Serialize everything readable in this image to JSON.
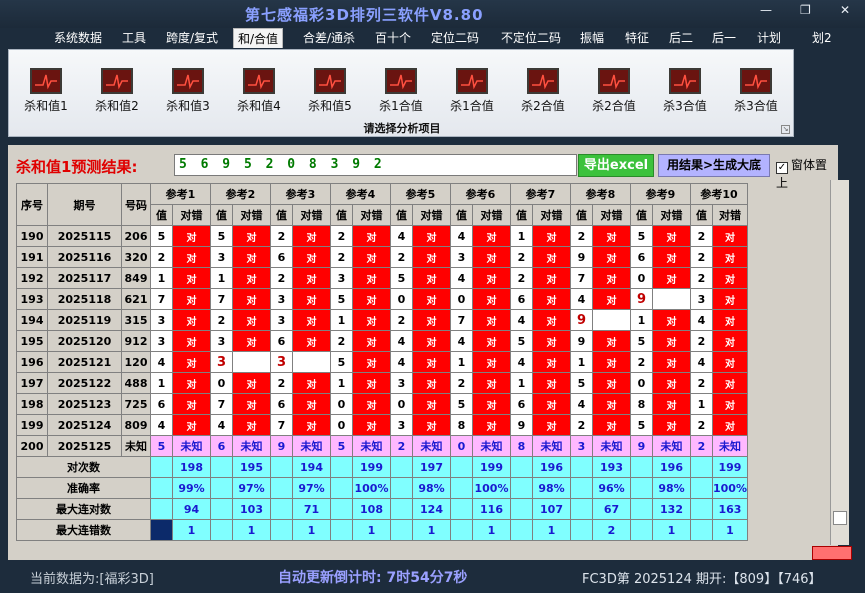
{
  "app": {
    "title": "第七感福彩3D排列三软件V8.80"
  },
  "menu": [
    "系统数据",
    "工具",
    "跨度/复式",
    "和/合值",
    "合差/通杀",
    "百十个",
    "定位二码",
    "不定位二码",
    "振幅",
    "特征",
    "后二",
    "后一",
    "计划",
    "划2"
  ],
  "ribbon": {
    "buttons": [
      "杀和值1",
      "杀和值2",
      "杀和值3",
      "杀和值4",
      "杀和值5",
      "杀1合值",
      "杀1合值",
      "杀2合值",
      "杀2合值",
      "杀3合值",
      "杀3合值"
    ],
    "caption": "请选择分析项目"
  },
  "predict": {
    "label": "杀和值1预测结果:",
    "value": "5 6 9 5 2 0 8 3 9 2",
    "excel_button": "导出excel",
    "base_button": "用结果>生成大底",
    "topmost_label": "窗体置上"
  },
  "table": {
    "headers": {
      "seq": "序号",
      "period": "期号",
      "code": "号码",
      "refs": [
        "参考1",
        "参考2",
        "参考3",
        "参考4",
        "参考5",
        "参考6",
        "参考7",
        "参考8",
        "参考9",
        "参考10"
      ],
      "sub_value": "值",
      "sub_result": "对错"
    },
    "rows": [
      {
        "seq": "190",
        "period": "2025115",
        "code": "206",
        "cells": [
          [
            "5",
            "对"
          ],
          [
            "5",
            "对"
          ],
          [
            "2",
            "对"
          ],
          [
            "2",
            "对"
          ],
          [
            "4",
            "对"
          ],
          [
            "4",
            "对"
          ],
          [
            "1",
            "对"
          ],
          [
            "2",
            "对"
          ],
          [
            "5",
            "对"
          ],
          [
            "2",
            "对"
          ]
        ]
      },
      {
        "seq": "191",
        "period": "2025116",
        "code": "320",
        "cells": [
          [
            "2",
            "对"
          ],
          [
            "3",
            "对"
          ],
          [
            "6",
            "对"
          ],
          [
            "2",
            "对"
          ],
          [
            "2",
            "对"
          ],
          [
            "3",
            "对"
          ],
          [
            "2",
            "对"
          ],
          [
            "9",
            "对"
          ],
          [
            "6",
            "对"
          ],
          [
            "2",
            "对"
          ]
        ]
      },
      {
        "seq": "192",
        "period": "2025117",
        "code": "849",
        "cells": [
          [
            "1",
            "对"
          ],
          [
            "1",
            "对"
          ],
          [
            "2",
            "对"
          ],
          [
            "3",
            "对"
          ],
          [
            "5",
            "对"
          ],
          [
            "4",
            "对"
          ],
          [
            "2",
            "对"
          ],
          [
            "7",
            "对"
          ],
          [
            "0",
            "对"
          ],
          [
            "2",
            "对"
          ]
        ]
      },
      {
        "seq": "193",
        "period": "2025118",
        "code": "621",
        "cells": [
          [
            "7",
            "对"
          ],
          [
            "7",
            "对"
          ],
          [
            "3",
            "对"
          ],
          [
            "5",
            "对"
          ],
          [
            "0",
            "对"
          ],
          [
            "0",
            "对"
          ],
          [
            "6",
            "对"
          ],
          [
            "4",
            "对"
          ],
          [
            "9",
            ""
          ],
          [
            "3",
            "对"
          ]
        ]
      },
      {
        "seq": "194",
        "period": "2025119",
        "code": "315",
        "cells": [
          [
            "3",
            "对"
          ],
          [
            "2",
            "对"
          ],
          [
            "3",
            "对"
          ],
          [
            "1",
            "对"
          ],
          [
            "2",
            "对"
          ],
          [
            "7",
            "对"
          ],
          [
            "4",
            "对"
          ],
          [
            "9",
            ""
          ],
          [
            "1",
            "对"
          ],
          [
            "4",
            "对"
          ]
        ]
      },
      {
        "seq": "195",
        "period": "2025120",
        "code": "912",
        "cells": [
          [
            "3",
            "对"
          ],
          [
            "3",
            "对"
          ],
          [
            "6",
            "对"
          ],
          [
            "2",
            "对"
          ],
          [
            "4",
            "对"
          ],
          [
            "4",
            "对"
          ],
          [
            "5",
            "对"
          ],
          [
            "9",
            "对"
          ],
          [
            "5",
            "对"
          ],
          [
            "2",
            "对"
          ]
        ]
      },
      {
        "seq": "196",
        "period": "2025121",
        "code": "120",
        "cells": [
          [
            "4",
            "对"
          ],
          [
            "3",
            ""
          ],
          [
            "3",
            ""
          ],
          [
            "5",
            "对"
          ],
          [
            "4",
            "对"
          ],
          [
            "1",
            "对"
          ],
          [
            "4",
            "对"
          ],
          [
            "1",
            "对"
          ],
          [
            "2",
            "对"
          ],
          [
            "4",
            "对"
          ]
        ]
      },
      {
        "seq": "197",
        "period": "2025122",
        "code": "488",
        "cells": [
          [
            "1",
            "对"
          ],
          [
            "0",
            "对"
          ],
          [
            "2",
            "对"
          ],
          [
            "1",
            "对"
          ],
          [
            "3",
            "对"
          ],
          [
            "2",
            "对"
          ],
          [
            "1",
            "对"
          ],
          [
            "5",
            "对"
          ],
          [
            "0",
            "对"
          ],
          [
            "2",
            "对"
          ]
        ]
      },
      {
        "seq": "198",
        "period": "2025123",
        "code": "725",
        "cells": [
          [
            "6",
            "对"
          ],
          [
            "7",
            "对"
          ],
          [
            "6",
            "对"
          ],
          [
            "0",
            "对"
          ],
          [
            "0",
            "对"
          ],
          [
            "5",
            "对"
          ],
          [
            "6",
            "对"
          ],
          [
            "4",
            "对"
          ],
          [
            "8",
            "对"
          ],
          [
            "1",
            "对"
          ]
        ]
      },
      {
        "seq": "199",
        "period": "2025124",
        "code": "809",
        "cells": [
          [
            "4",
            "对"
          ],
          [
            "4",
            "对"
          ],
          [
            "7",
            "对"
          ],
          [
            "0",
            "对"
          ],
          [
            "3",
            "对"
          ],
          [
            "8",
            "对"
          ],
          [
            "9",
            "对"
          ],
          [
            "2",
            "对"
          ],
          [
            "5",
            "对"
          ],
          [
            "2",
            "对"
          ]
        ]
      }
    ],
    "pending": {
      "seq": "200",
      "period": "2025125",
      "code": "未知",
      "cells": [
        [
          "5",
          "未知"
        ],
        [
          "6",
          "未知"
        ],
        [
          "9",
          "未知"
        ],
        [
          "5",
          "未知"
        ],
        [
          "2",
          "未知"
        ],
        [
          "0",
          "未知"
        ],
        [
          "8",
          "未知"
        ],
        [
          "3",
          "未知"
        ],
        [
          "9",
          "未知"
        ],
        [
          "2",
          "未知"
        ]
      ]
    },
    "stats": [
      {
        "label": "对次数",
        "values": [
          "198",
          "195",
          "194",
          "199",
          "197",
          "199",
          "196",
          "193",
          "196",
          "199"
        ]
      },
      {
        "label": "准确率",
        "values": [
          "99%",
          "97%",
          "97%",
          "100%",
          "98%",
          "100%",
          "98%",
          "96%",
          "98%",
          "100%"
        ]
      },
      {
        "label": "最大连对数",
        "values": [
          "94",
          "103",
          "71",
          "108",
          "124",
          "116",
          "107",
          "67",
          "132",
          "163"
        ]
      },
      {
        "label": "最大连错数",
        "values": [
          "1",
          "1",
          "1",
          "1",
          "1",
          "1",
          "1",
          "2",
          "1",
          "1"
        ]
      }
    ]
  },
  "status": {
    "current_data": "当前数据为:[福彩3D]",
    "countdown": "自动更新倒计时: 7时54分7秒",
    "latest": "FC3D第 2025124 期开:【809】【746】"
  }
}
